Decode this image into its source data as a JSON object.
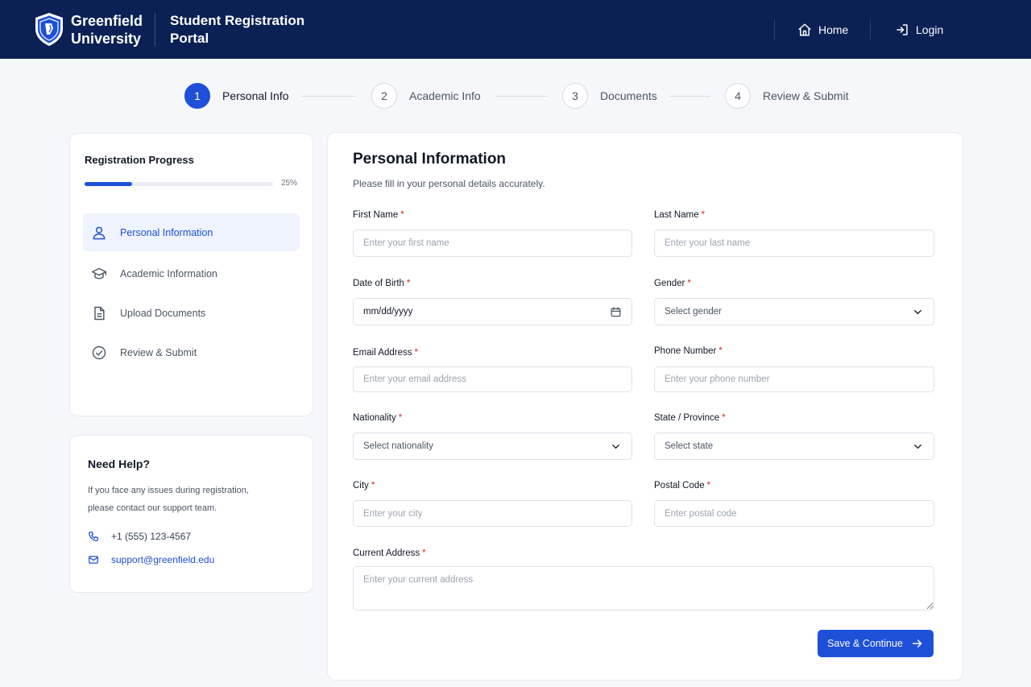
{
  "header": {
    "brand_line1": "Greenfield",
    "brand_line2": "University",
    "portal_line1": "Student Registration",
    "portal_line2": "Portal",
    "nav_home": "Home",
    "nav_login": "Login"
  },
  "stepper": [
    {
      "num": "1",
      "label": "Personal Info",
      "active": true
    },
    {
      "num": "2",
      "label": "Academic Info",
      "active": false
    },
    {
      "num": "3",
      "label": "Documents",
      "active": false
    },
    {
      "num": "4",
      "label": "Review & Submit",
      "active": false
    }
  ],
  "progress": {
    "title": "Registration Progress",
    "percent_label": "25%",
    "fraction": 0.25
  },
  "sidebar": {
    "items": [
      {
        "label": "Personal Information",
        "icon": "user-icon",
        "active": true
      },
      {
        "label": "Academic Information",
        "icon": "graduation-cap-icon",
        "active": false
      },
      {
        "label": "Upload Documents",
        "icon": "document-icon",
        "active": false
      },
      {
        "label": "Review & Submit",
        "icon": "check-circle-icon",
        "active": false
      }
    ]
  },
  "help": {
    "title": "Need Help?",
    "text_line1": "If you face any issues during registration,",
    "text_line2": "please contact our support team.",
    "phone": "+1 (555) 123-4567",
    "email": "support@greenfield.edu"
  },
  "form": {
    "title": "Personal Information",
    "subtitle": "Please fill in your personal details accurately.",
    "first_name": {
      "label": "First Name",
      "placeholder": "Enter your first name"
    },
    "last_name": {
      "label": "Last Name",
      "placeholder": "Enter your last name"
    },
    "dob": {
      "label": "Date of Birth",
      "value": "mm/dd/yyyy"
    },
    "gender": {
      "label": "Gender",
      "placeholder": "Select gender"
    },
    "email": {
      "label": "Email Address",
      "placeholder": "Enter your email address"
    },
    "phone": {
      "label": "Phone Number",
      "placeholder": "Enter your phone number"
    },
    "nationality": {
      "label": "Nationality",
      "placeholder": "Select nationality"
    },
    "state": {
      "label": "State / Province",
      "placeholder": "Select state"
    },
    "city": {
      "label": "City",
      "placeholder": "Enter your city"
    },
    "postal": {
      "label": "Postal Code",
      "placeholder": "Enter postal code"
    },
    "address": {
      "label": "Current Address",
      "placeholder": "Enter your current address"
    },
    "required_mark": "*",
    "save_label": "Save & Continue"
  },
  "colors": {
    "header_bg": "#0b2155",
    "accent": "#1d4fd8",
    "required": "#dc2626"
  }
}
